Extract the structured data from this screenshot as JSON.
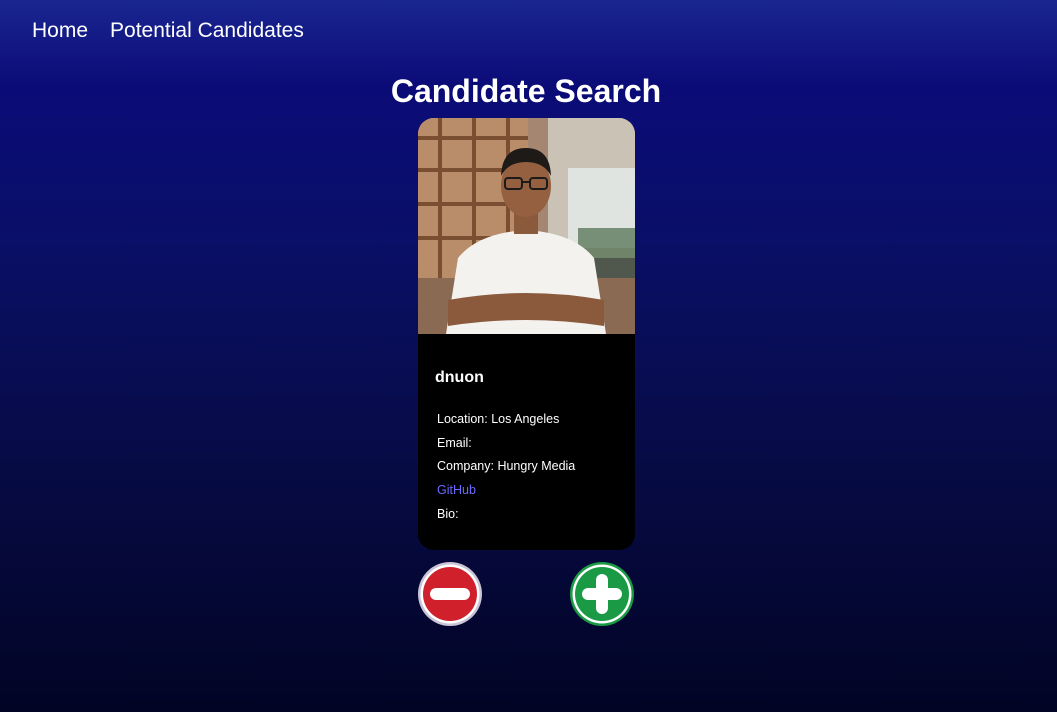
{
  "nav": {
    "home": "Home",
    "potential_candidates": "Potential Candidates"
  },
  "page": {
    "title": "Candidate Search"
  },
  "candidate": {
    "username": "dnuon",
    "location": "Location: Los Angeles",
    "email": "Email:",
    "company": "Company: Hungry Media",
    "github_link": "GitHub",
    "bio": "Bio:"
  },
  "icons": {
    "reject": "minus-circle-icon",
    "accept": "plus-circle-icon"
  },
  "colors": {
    "reject": "#d0202c",
    "accept": "#1a9a45",
    "link": "#6b6bff",
    "card_background": "#000000"
  }
}
